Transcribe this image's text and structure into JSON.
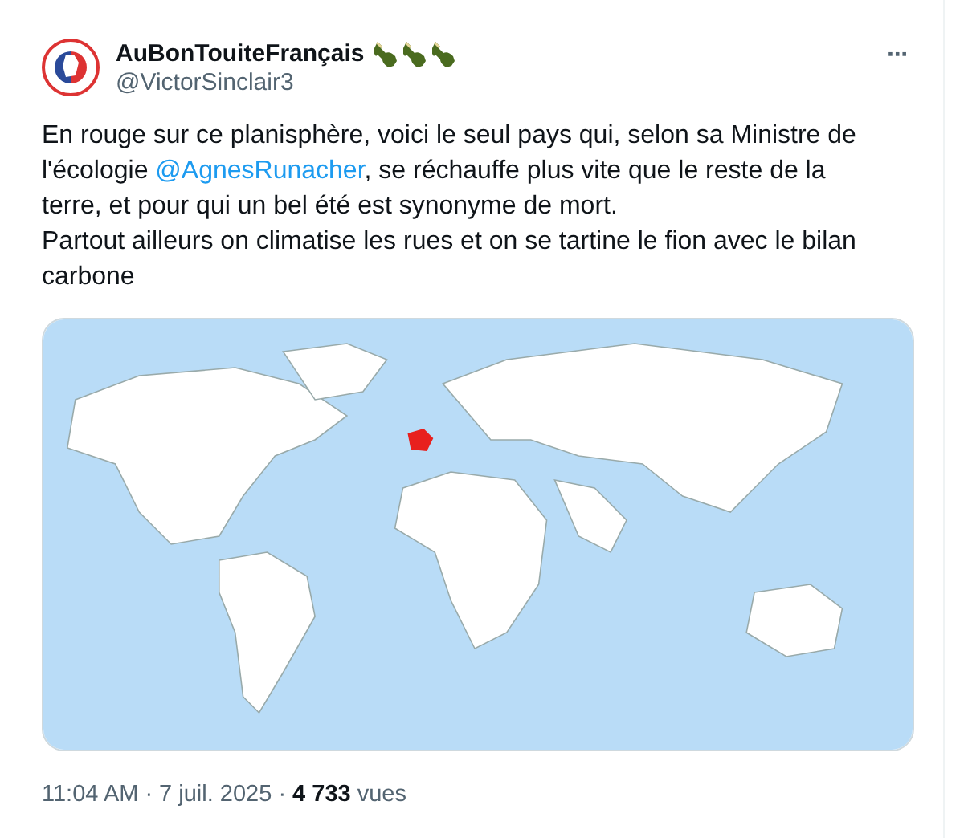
{
  "author": {
    "name": "AuBonTouiteFrançais",
    "handle": "@VictorSinclair3"
  },
  "more": "···",
  "paragraphs": [
    "En rouge sur ce planisphère, voici le seul pays qui, selon sa Ministre de l'écologie **@AgnesRunacher**, se réchauffe plus vite que le reste de la terre, et pour qui un bel été est synonyme de mort.",
    "Partout ailleurs on climatise les rues et on se tartine le fion avec le bilan carbone"
  ],
  "footer": {
    "separator": "·",
    "time": "11:04 AM",
    "date": "7 juil. 2025",
    "views_count": "4 733",
    "views_label": "vues"
  }
}
